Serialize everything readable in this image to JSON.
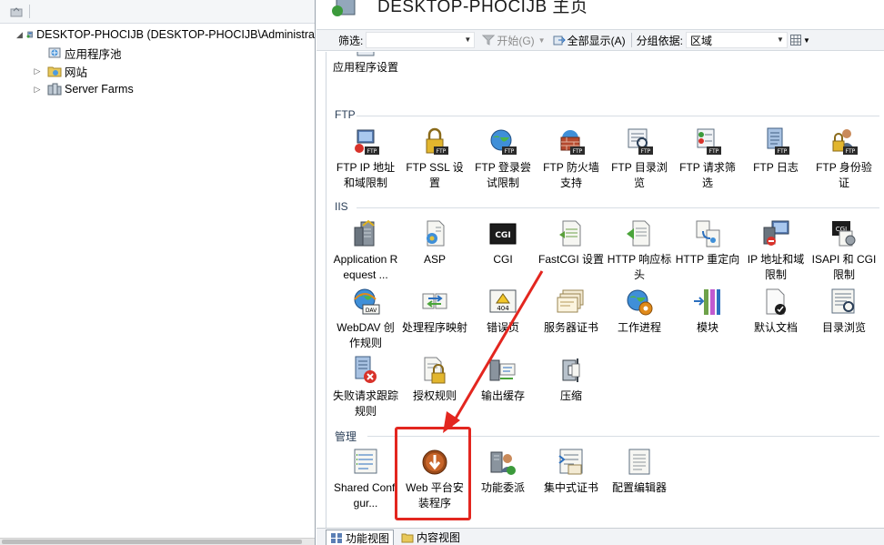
{
  "tree": {
    "root_label": "DESKTOP-PHOCIJB (DESKTOP-PHOCIJB\\Administra",
    "children": [
      {
        "label": "应用程序池"
      },
      {
        "label": "网站"
      },
      {
        "label": "Server Farms"
      }
    ]
  },
  "header": {
    "title": "DESKTOP-PHOCIJB 主页"
  },
  "filter_bar": {
    "filter_label": "筛选:",
    "start_label": "开始(G)",
    "show_all_label": "全部显示(A)",
    "group_by_label": "分组依据:",
    "group_by_value": "区域"
  },
  "groups": {
    "partial_item": "应用程序设置",
    "ftp": {
      "title": "FTP",
      "items": [
        {
          "label": "FTP IP 地址和域限制",
          "icon": "ftp-ip-restriction-icon"
        },
        {
          "label": "FTP SSL 设置",
          "icon": "ftp-ssl-lock-icon"
        },
        {
          "label": "FTP 登录尝试限制",
          "icon": "ftp-logon-globe-icon"
        },
        {
          "label": "FTP 防火墙支持",
          "icon": "ftp-firewall-icon"
        },
        {
          "label": "FTP 目录浏览",
          "icon": "ftp-directory-browse-icon"
        },
        {
          "label": "FTP 请求筛选",
          "icon": "ftp-request-filter-icon"
        },
        {
          "label": "FTP 日志",
          "icon": "ftp-log-icon"
        },
        {
          "label": "FTP 身份验证",
          "icon": "ftp-authentication-icon"
        }
      ]
    },
    "iis": {
      "title": "IIS",
      "items": [
        {
          "label": "Application Request ...",
          "icon": "arr-server-icon"
        },
        {
          "label": "ASP",
          "icon": "asp-icon"
        },
        {
          "label": "CGI",
          "icon": "cgi-icon"
        },
        {
          "label": "FastCGI 设置",
          "icon": "fastcgi-icon"
        },
        {
          "label": "HTTP 响应标头",
          "icon": "http-response-headers-icon"
        },
        {
          "label": "HTTP 重定向",
          "icon": "http-redirect-icon"
        },
        {
          "label": "IP 地址和域限制",
          "icon": "ip-restriction-icon"
        },
        {
          "label": "ISAPI 和 CGI 限制",
          "icon": "isapi-cgi-icon"
        },
        {
          "label": "WebDAV 创作规则",
          "icon": "webdav-icon"
        },
        {
          "label": "处理程序映射",
          "icon": "handler-mappings-icon"
        },
        {
          "label": "错误页",
          "icon": "error-pages-icon"
        },
        {
          "label": "服务器证书",
          "icon": "server-certificates-icon"
        },
        {
          "label": "工作进程",
          "icon": "worker-processes-icon"
        },
        {
          "label": "模块",
          "icon": "modules-icon"
        },
        {
          "label": "默认文档",
          "icon": "default-document-icon"
        },
        {
          "label": "目录浏览",
          "icon": "directory-browsing-icon"
        },
        {
          "label": "失败请求跟踪规则",
          "icon": "failed-request-icon"
        },
        {
          "label": "授权规则",
          "icon": "authorization-rules-icon"
        },
        {
          "label": "输出缓存",
          "icon": "output-caching-icon"
        },
        {
          "label": "压缩",
          "icon": "compression-icon"
        }
      ]
    },
    "manage": {
      "title": "管理",
      "items": [
        {
          "label": "Shared Configur...",
          "icon": "shared-config-icon"
        },
        {
          "label": "Web 平台安装程序",
          "icon": "web-platform-installer-icon"
        },
        {
          "label": "功能委派",
          "icon": "feature-delegation-icon"
        },
        {
          "label": "集中式证书",
          "icon": "centralized-certificates-icon"
        },
        {
          "label": "配置编辑器",
          "icon": "configuration-editor-icon"
        }
      ]
    }
  },
  "bottom_tabs": {
    "features_view": "功能视图",
    "content_view": "内容视图"
  },
  "colors": {
    "annotation_red": "#e3261f",
    "group_header": "#2a3e57"
  }
}
